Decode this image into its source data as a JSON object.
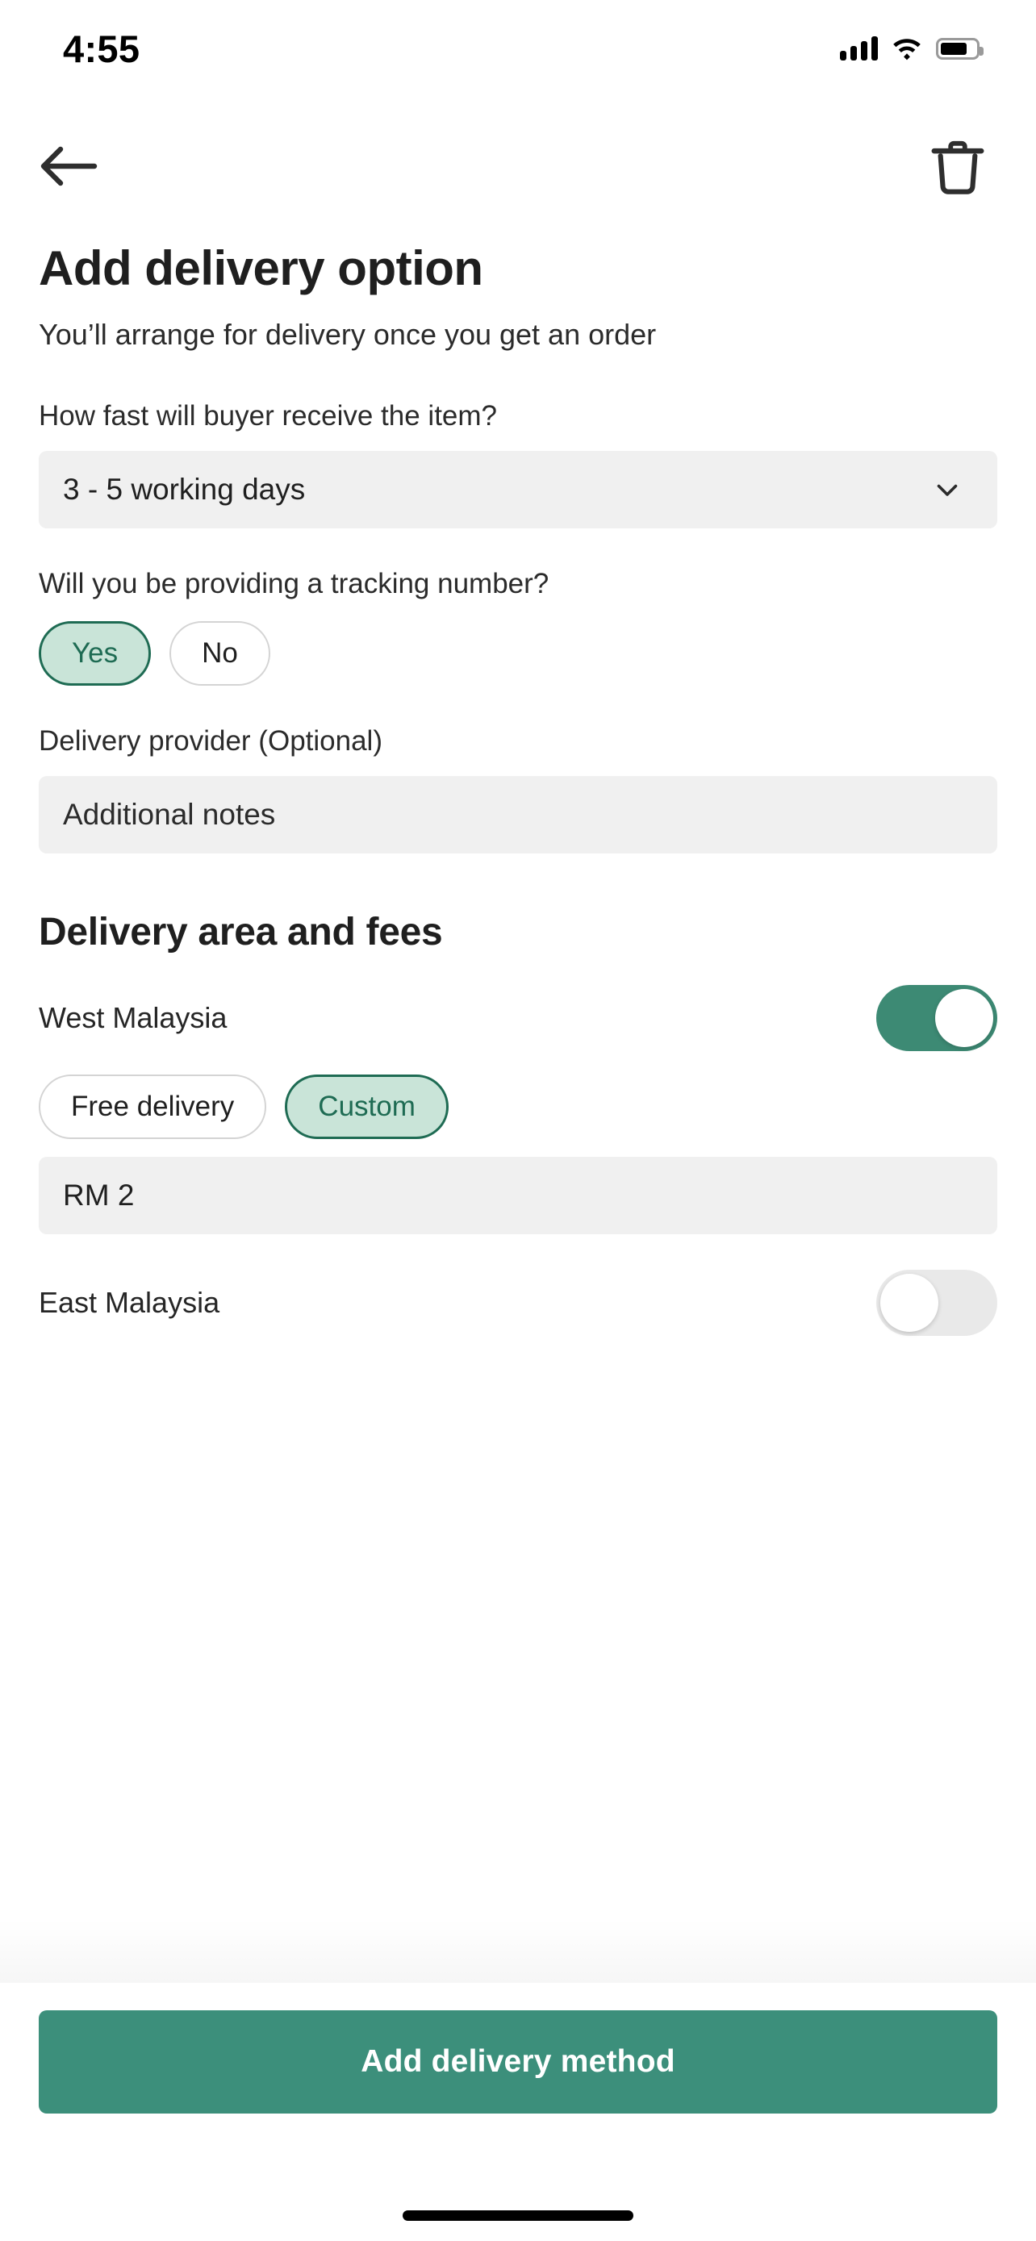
{
  "status_bar": {
    "time": "4:55",
    "signal_icon": "cellular-signal-icon",
    "wifi_icon": "wifi-icon",
    "battery_icon": "battery-icon"
  },
  "nav": {
    "back_icon": "back-arrow-icon",
    "delete_icon": "trash-icon"
  },
  "header": {
    "title": "Add delivery option",
    "subtitle": "You’ll arrange for delivery once you get an order"
  },
  "speed": {
    "label": "How fast will buyer receive the item?",
    "selected": "3 - 5 working days",
    "chevron_icon": "chevron-down-icon"
  },
  "tracking": {
    "label": "Will you be providing a tracking number?",
    "options": [
      {
        "label": "Yes",
        "selected": true
      },
      {
        "label": "No",
        "selected": false
      }
    ]
  },
  "provider": {
    "label": "Delivery provider (Optional)",
    "value": "",
    "placeholder": "Additional notes"
  },
  "delivery_area": {
    "section_title": "Delivery area and fees",
    "regions": [
      {
        "name": "West Malaysia",
        "enabled": true,
        "fee_options": [
          {
            "label": "Free delivery",
            "selected": false
          },
          {
            "label": "Custom",
            "selected": true
          }
        ],
        "fee_value": "RM 2"
      },
      {
        "name": "East Malaysia",
        "enabled": false
      }
    ]
  },
  "footer": {
    "cta_label": "Add delivery method"
  },
  "colors": {
    "accent_green": "#3c8f7b",
    "toggle_on": "#3d8a74",
    "pill_selected_bg": "#c9e4d8",
    "pill_selected_border": "#1e6b53",
    "field_bg": "#f0f0f0",
    "text_primary": "#1f1f1f"
  }
}
